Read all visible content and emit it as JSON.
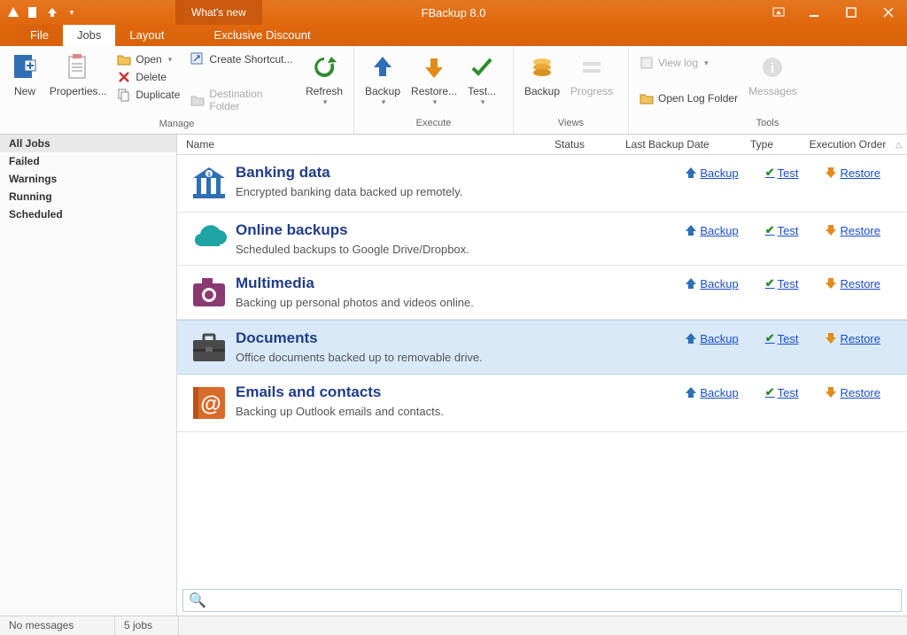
{
  "titlebar": {
    "whats_new": "What's new",
    "app_title": "FBackup 8.0"
  },
  "tabs": {
    "file": "File",
    "jobs": "Jobs",
    "layout": "Layout",
    "exclusive_discount": "Exclusive Discount"
  },
  "ribbon": {
    "new": "New",
    "properties": "Properties...",
    "open": "Open",
    "delete": "Delete",
    "duplicate": "Duplicate",
    "create_shortcut": "Create Shortcut...",
    "destination_folder": "Destination Folder",
    "refresh": "Refresh",
    "backup": "Backup",
    "restore": "Restore...",
    "test": "Test...",
    "backup2": "Backup",
    "progress": "Progress",
    "view_log": "View log",
    "open_log_folder": "Open Log Folder",
    "messages": "Messages",
    "group_manage": "Manage",
    "group_execute": "Execute",
    "group_views": "Views",
    "group_tools": "Tools"
  },
  "sidebar": {
    "items": [
      {
        "label": "All Jobs",
        "active": true
      },
      {
        "label": "Failed"
      },
      {
        "label": "Warnings"
      },
      {
        "label": "Running"
      },
      {
        "label": "Scheduled"
      }
    ]
  },
  "columns": {
    "name": "Name",
    "status": "Status",
    "last_backup": "Last Backup Date",
    "type": "Type",
    "execution_order": "Execution Order"
  },
  "actions": {
    "backup": "Backup",
    "test": "Test",
    "restore": "Restore"
  },
  "jobs": [
    {
      "title": "Banking data",
      "desc": "Encrypted banking data backed up remotely.",
      "icon": "bank",
      "selected": false
    },
    {
      "title": "Online backups",
      "desc": "Scheduled backups to Google Drive/Dropbox.",
      "icon": "cloud",
      "selected": false
    },
    {
      "title": "Multimedia",
      "desc": "Backing up personal photos and videos online.",
      "icon": "camera",
      "selected": false
    },
    {
      "title": "Documents",
      "desc": "Office documents backed up to removable drive.",
      "icon": "briefcase",
      "selected": true
    },
    {
      "title": "Emails and contacts",
      "desc": "Backing up Outlook emails and contacts.",
      "icon": "at",
      "selected": false
    }
  ],
  "statusbar": {
    "messages": "No messages",
    "jobs": "5 jobs"
  }
}
